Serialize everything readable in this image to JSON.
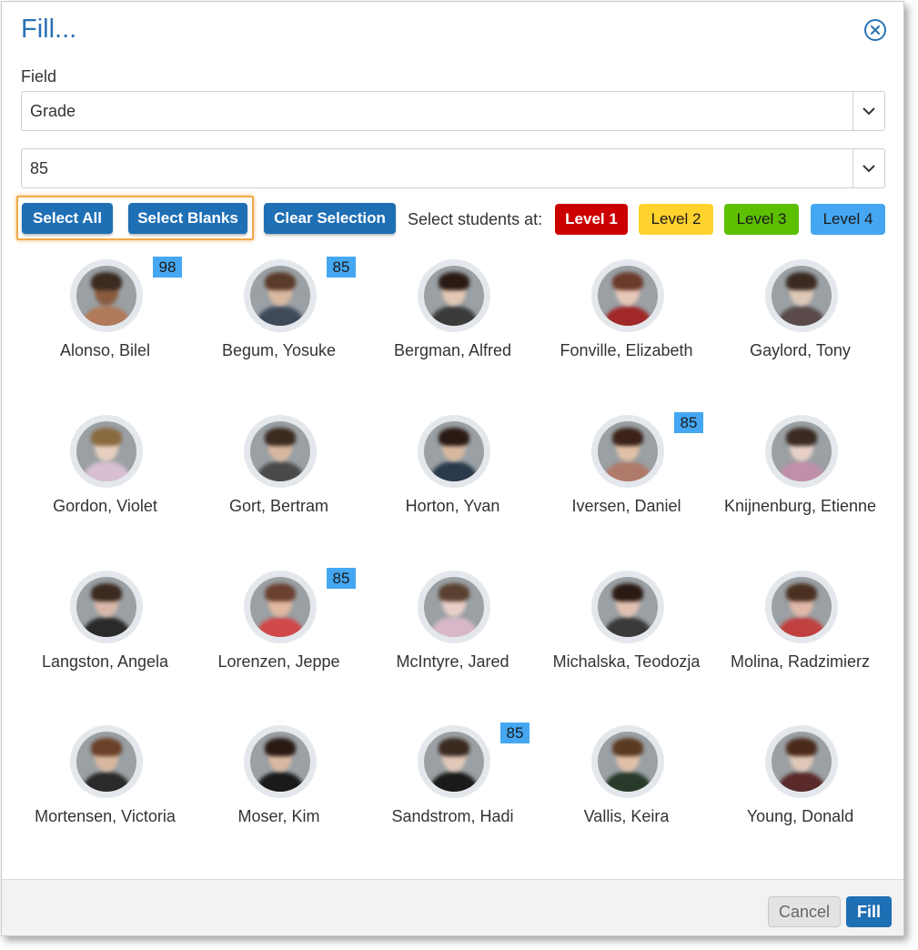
{
  "dialog": {
    "title": "Fill...",
    "field_label": "Field",
    "field_value": "Grade",
    "value_value": "85"
  },
  "toolbar": {
    "select_all": "Select All",
    "select_blanks": "Select Blanks",
    "clear_selection": "Clear Selection",
    "select_at": "Select students at:",
    "levels": [
      {
        "label": "Level 1",
        "bg": "#cc0000",
        "fg": "#ffffff"
      },
      {
        "label": "Level 2",
        "bg": "#ffd22e",
        "fg": "#1a1a1a"
      },
      {
        "label": "Level 3",
        "bg": "#5cbf00",
        "fg": "#1a1a1a"
      },
      {
        "label": "Level 4",
        "bg": "#45a7f2",
        "fg": "#1a1a1a"
      }
    ]
  },
  "students": [
    {
      "name": "Alonso, Bilel",
      "grade": "98"
    },
    {
      "name": "Begum, Yosuke",
      "grade": "85"
    },
    {
      "name": "Bergman, Alfred",
      "grade": ""
    },
    {
      "name": "Fonville, Elizabeth",
      "grade": ""
    },
    {
      "name": "Gaylord, Tony",
      "grade": ""
    },
    {
      "name": "Gordon, Violet",
      "grade": ""
    },
    {
      "name": "Gort, Bertram",
      "grade": ""
    },
    {
      "name": "Horton, Yvan",
      "grade": ""
    },
    {
      "name": "Iversen, Daniel",
      "grade": "85"
    },
    {
      "name": "Knijnenburg, Etienne",
      "grade": ""
    },
    {
      "name": "Langston, Angela",
      "grade": ""
    },
    {
      "name": "Lorenzen, Jeppe",
      "grade": "85"
    },
    {
      "name": "McIntyre, Jared",
      "grade": ""
    },
    {
      "name": "Michalska, Teodozja",
      "grade": ""
    },
    {
      "name": "Molina, Radzimierz",
      "grade": ""
    },
    {
      "name": "Mortensen, Victoria",
      "grade": ""
    },
    {
      "name": "Moser, Kim",
      "grade": ""
    },
    {
      "name": "Sandstrom, Hadi",
      "grade": "85"
    },
    {
      "name": "Vallis, Keira",
      "grade": ""
    },
    {
      "name": "Young, Donald",
      "grade": ""
    }
  ],
  "footer": {
    "cancel": "Cancel",
    "fill": "Fill"
  },
  "colors": {
    "accent": "#1f6fb5",
    "badge": "#45a7f2",
    "highlight": "#f2a94a"
  },
  "icons": {
    "close": "close-circle-icon",
    "caret": "chevron-down-icon"
  }
}
